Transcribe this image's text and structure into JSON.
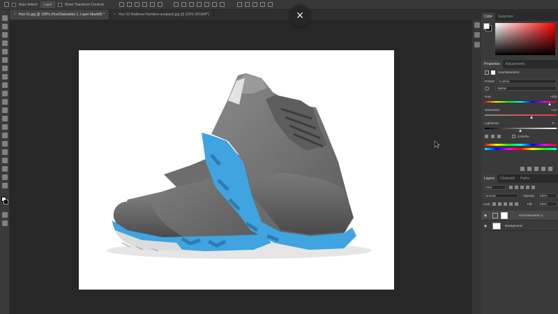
{
  "options_bar": {
    "auto_select_label": "Auto-Select:",
    "auto_select_value": "Layer",
    "transform_label": "Show Transform Controls"
  },
  "tabs": [
    {
      "label": "Hue 01.jpg @ 100% (Hue/Saturation 1, Layer Mask/8) *",
      "active": true
    },
    {
      "label": "Hue 02 Matthew-Hamilton-unsplash.jpg @ 100% (RGB/8*)",
      "active": false
    }
  ],
  "overlay": {
    "close_glyph": "×"
  },
  "color_panel": {
    "tabs": [
      "Color",
      "Swatches"
    ],
    "hue_color": "#ff0000"
  },
  "properties_panel": {
    "tabs": [
      "Properties",
      "Adjustments"
    ],
    "title": "Hue/Saturation",
    "preset_label": "Preset:",
    "preset_value": "Custom",
    "channel_value": "Master",
    "hue_label": "Hue:",
    "hue_value": "+153",
    "saturation_label": "Saturation:",
    "saturation_value": "+13",
    "lightness_label": "Lightness:",
    "lightness_value": "0",
    "colorize_label": "Colorize"
  },
  "layers_panel": {
    "tabs": [
      "Layers",
      "Channels",
      "Paths"
    ],
    "filter_value": "Kind",
    "blend_mode": "Normal",
    "opacity_label": "Opacity:",
    "opacity_value": "100%",
    "lock_label": "Lock:",
    "fill_label": "Fill:",
    "fill_value": "100%",
    "layers": [
      {
        "name": "Hue/Saturation 1",
        "selected": true
      },
      {
        "name": "Background",
        "selected": false
      }
    ]
  },
  "canvas": {
    "subject": "gray sneakers with blue soles",
    "sole_color": "#3fa4e0"
  }
}
